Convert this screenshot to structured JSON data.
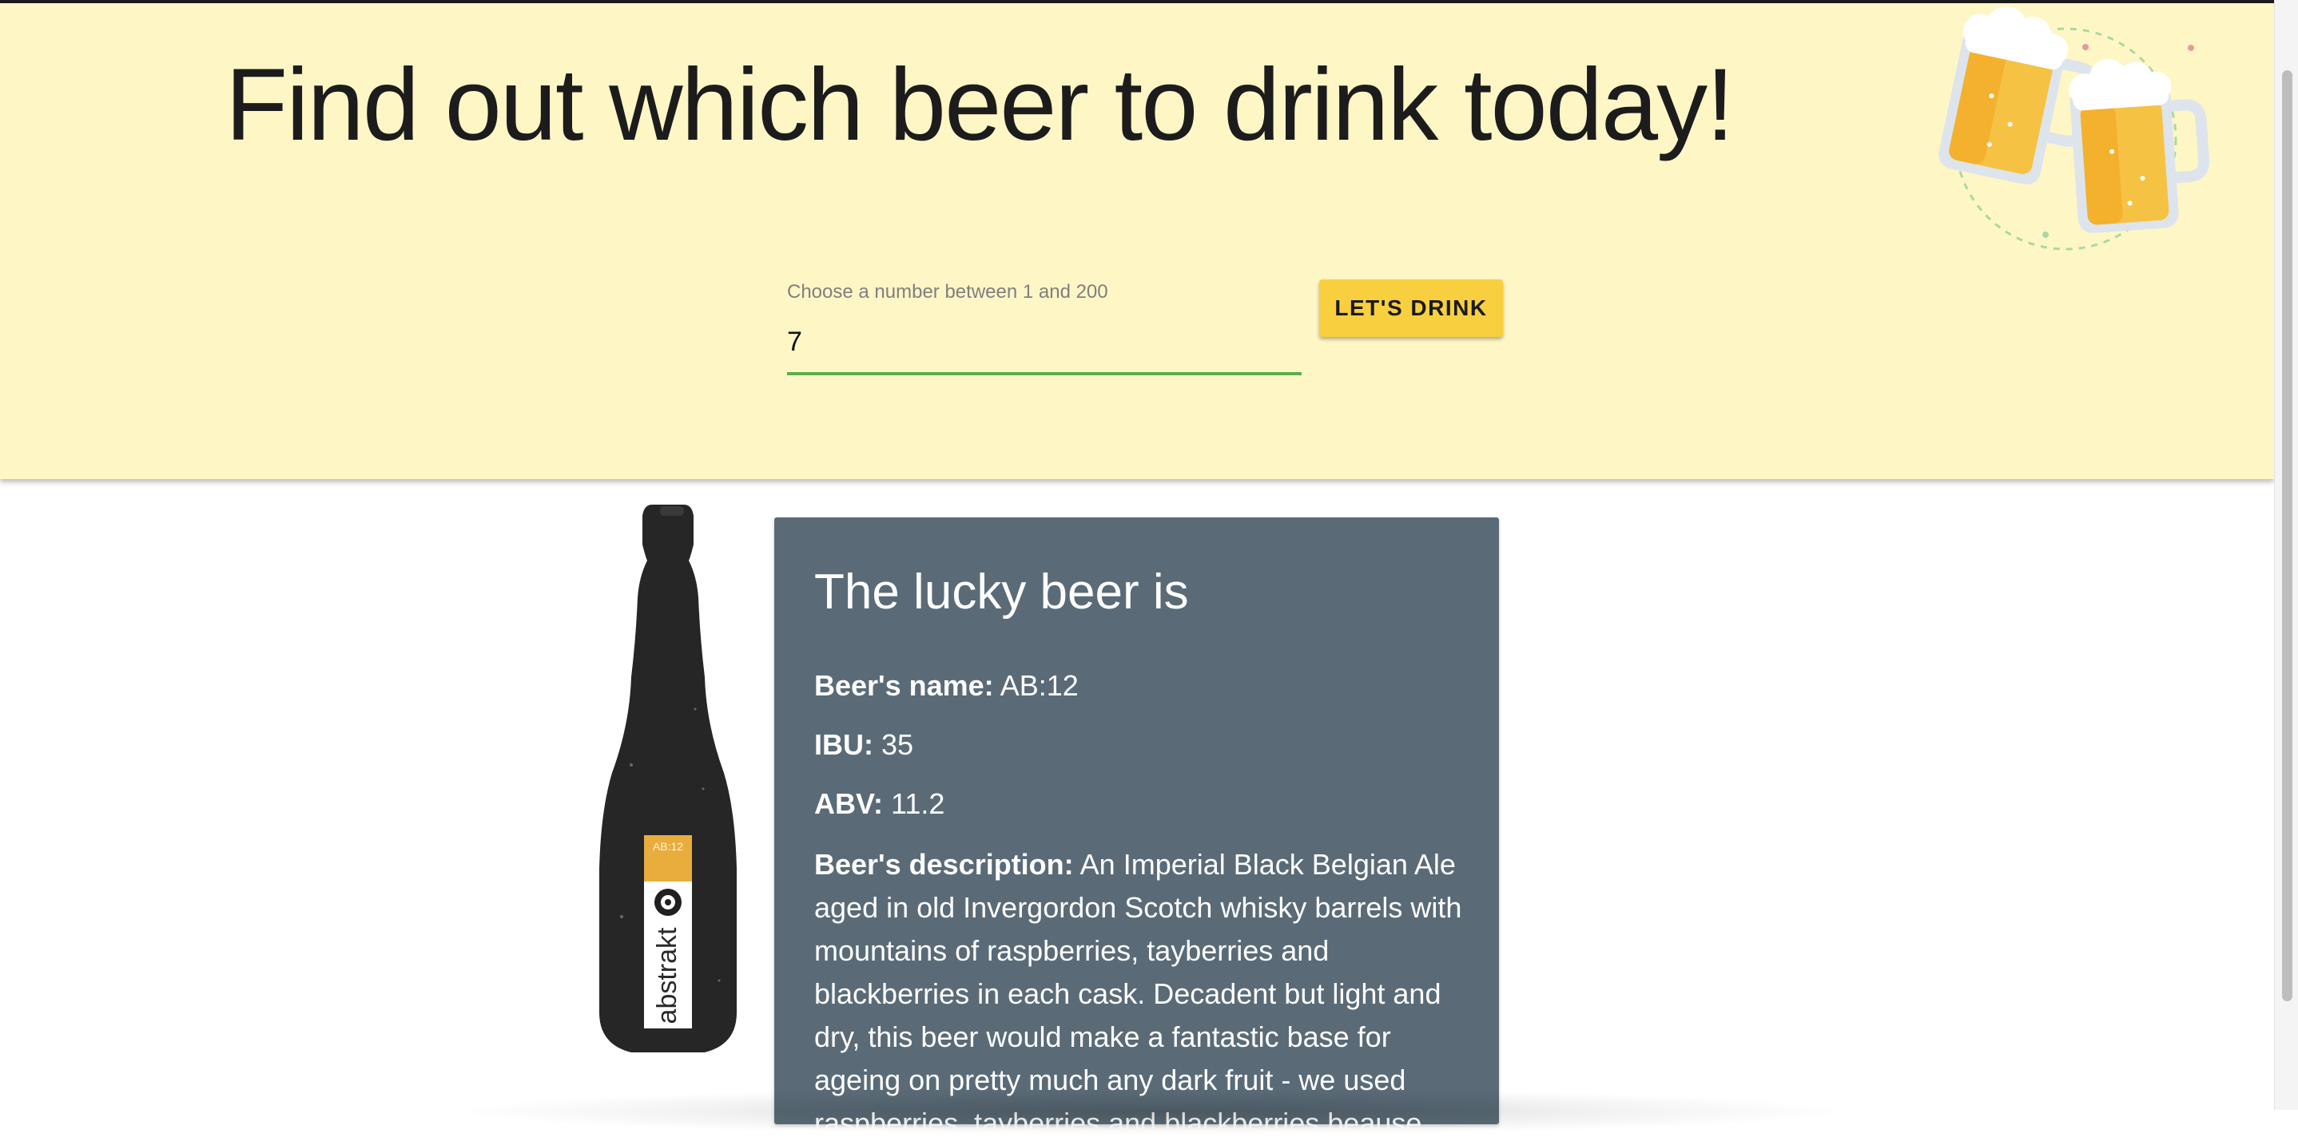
{
  "header": {
    "title": "Find out which beer to drink today!",
    "input_label": "Choose a number between 1 and 200",
    "input_value": "7",
    "button_label": "LET'S DRINK",
    "illustration_icon": "beer-mugs-icon"
  },
  "result": {
    "title": "The lucky beer is",
    "name_label": "Beer's name:",
    "name_value": "AB:12",
    "ibu_label": "IBU:",
    "ibu_value": "35",
    "abv_label": "ABV:",
    "abv_value": "11.2",
    "description_label": "Beer's description:",
    "description_text": "An Imperial Black Belgian Ale aged in old Invergordon Scotch whisky barrels with mountains of raspberries, tayberries and blackberries in each cask. Decadent but light and dry, this beer would make a fantastic base for ageing on pretty much any dark fruit - we used raspberries, tayberries and blackberries beause"
  },
  "bottle": {
    "label_tag": "AB:12",
    "brand": "abstrakt",
    "icon": "beer-bottle-icon"
  },
  "colors": {
    "header_bg": "#fff6c6",
    "button_bg": "#f8cf3e",
    "input_underline": "#5cad4c",
    "card_bg": "#5a6b77"
  }
}
